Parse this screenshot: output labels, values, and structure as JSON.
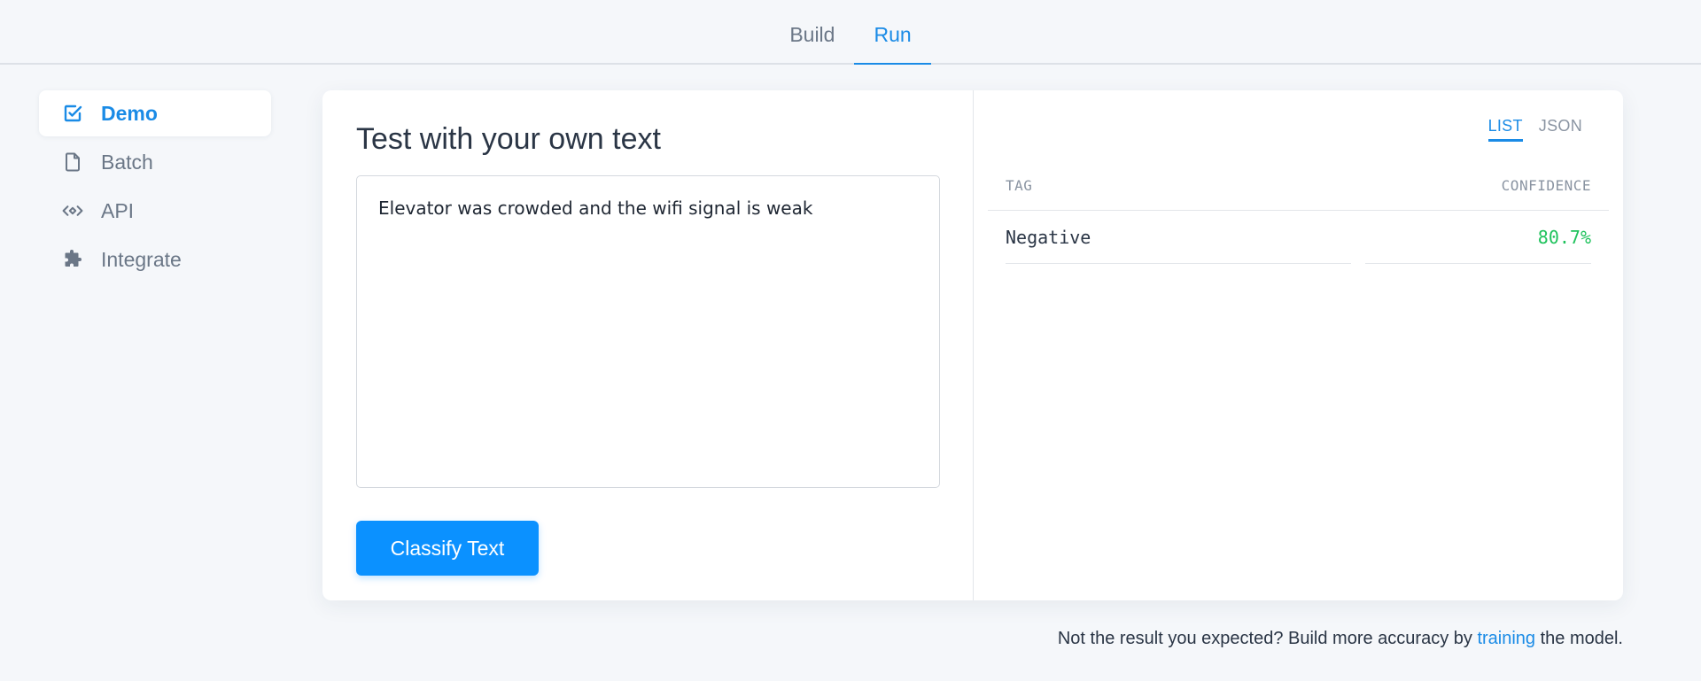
{
  "top_nav": {
    "tabs": [
      {
        "label": "Build",
        "active": false
      },
      {
        "label": "Run",
        "active": true
      }
    ]
  },
  "sidebar": {
    "items": [
      {
        "label": "Demo",
        "icon": "checkbox-icon",
        "active": true
      },
      {
        "label": "Batch",
        "icon": "document-icon",
        "active": false
      },
      {
        "label": "API",
        "icon": "code-icon",
        "active": false
      },
      {
        "label": "Integrate",
        "icon": "puzzle-icon",
        "active": false
      }
    ]
  },
  "demo": {
    "title": "Test with your own text",
    "input_value": "Elevator was crowded and the wifi signal is weak",
    "classify_label": "Classify Text"
  },
  "results": {
    "view_options": {
      "list": "LIST",
      "json": "JSON"
    },
    "active_view": "LIST",
    "columns": {
      "tag": "TAG",
      "confidence": "CONFIDENCE"
    },
    "rows": [
      {
        "tag": "Negative",
        "confidence": "80.7%"
      }
    ]
  },
  "footer": {
    "prefix": "Not the result you expected? Build more accuracy by ",
    "link": "training",
    "suffix": " the model."
  },
  "colors": {
    "accent": "#1a8be6",
    "button": "#0b91ff",
    "confidence_positive": "#1fc25c",
    "background": "#f5f7fa"
  }
}
